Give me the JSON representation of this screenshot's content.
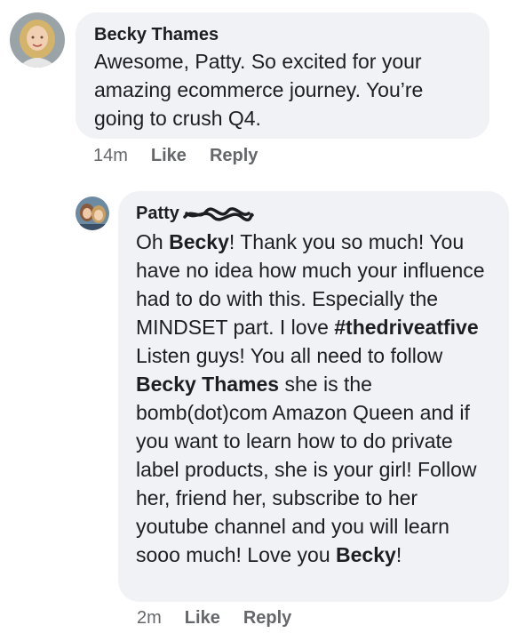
{
  "comment": {
    "author": "Becky Thames",
    "text": "Awesome, Patty.  So excited for your amazing ecommerce journey.  You’re going to crush Q4.",
    "time": "14m",
    "like_label": "Like",
    "reply_label": "Reply"
  },
  "reply": {
    "author": "Patty",
    "segments": [
      {
        "t": "Oh ",
        "b": false
      },
      {
        "t": "Becky",
        "b": true
      },
      {
        "t": "! Thank you so much! You have no idea how much your influence had to do with this. Especially the MINDSET part. I love ",
        "b": false
      },
      {
        "t": "#thedriveatfive",
        "b": true
      },
      {
        "t": " Listen guys! You all need to follow ",
        "b": false
      },
      {
        "t": "Becky Thames",
        "b": true
      },
      {
        "t": " she is the bomb(dot)com Amazon Queen and if you want to learn how to do private label products, she is your girl! Follow her, friend her, subscribe to her youtube channel and you will learn sooo much! Love you ",
        "b": false
      },
      {
        "t": "Becky",
        "b": true
      },
      {
        "t": "!",
        "b": false
      }
    ],
    "time": "2m",
    "like_label": "Like",
    "reply_label": "Reply"
  },
  "colors": {
    "bubble": "#f0f2f5",
    "text": "#1c1e21",
    "meta": "#65676b"
  },
  "icons": {
    "comment_avatar": "profile-photo",
    "reply_avatar": "profile-photo",
    "name_redaction": "scribble"
  }
}
